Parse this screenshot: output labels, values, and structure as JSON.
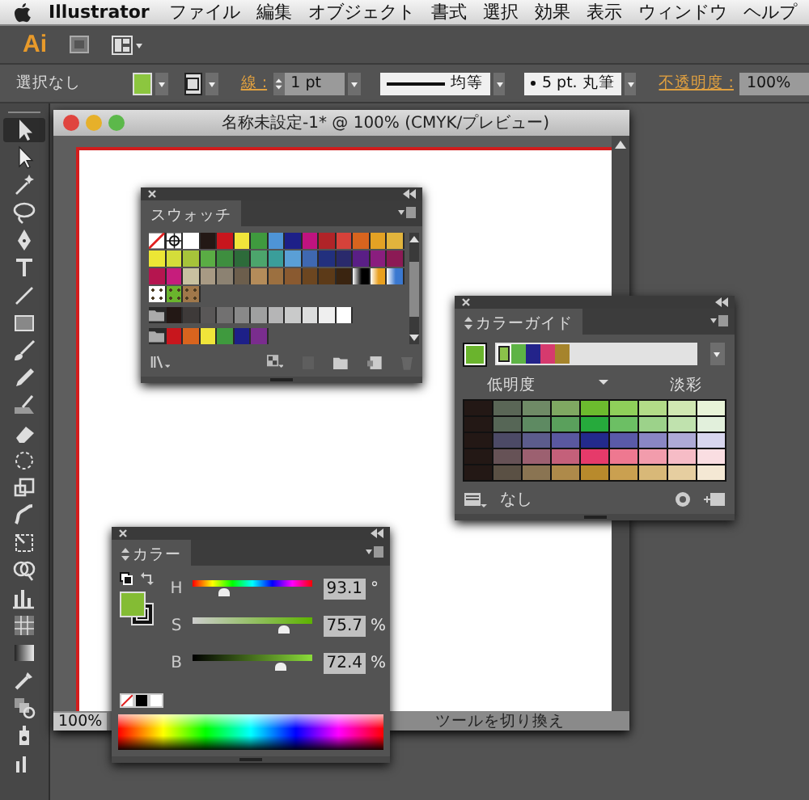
{
  "menu_bar": {
    "app": "Illustrator",
    "items": [
      "ファイル",
      "編集",
      "オブジェクト",
      "書式",
      "選択",
      "効果",
      "表示",
      "ウィンドウ",
      "ヘルプ"
    ]
  },
  "app_bar": {
    "logo": "Ai"
  },
  "control_bar": {
    "selection": "選択なし",
    "fill": {
      "color": "#8cc63f"
    },
    "stroke_label": "線 :",
    "stroke_weight": "1 pt",
    "stroke_profile": "均等",
    "brush": "5 pt. 丸筆",
    "opacity_label": "不透明度 :",
    "opacity": "100%"
  },
  "document": {
    "title": "名称未設定-1* @ 100% (CMYK/プレビュー)",
    "zoom": "100%",
    "status": "ツールを切り換え"
  },
  "swatches_panel": {
    "tab": "スウォッチ",
    "rows": [
      [
        {
          "kind": "none"
        },
        {
          "kind": "registration"
        },
        {
          "kind": "solid",
          "color": "#ffffff"
        },
        {
          "kind": "solid",
          "color": "#231815"
        },
        {
          "kind": "solid",
          "color": "#c8161d"
        },
        {
          "kind": "solid",
          "color": "#f0e53a"
        },
        {
          "kind": "solid",
          "color": "#3f9a3e"
        },
        {
          "kind": "solid",
          "color": "#4e94d6"
        },
        {
          "kind": "solid",
          "color": "#1d2088"
        },
        {
          "kind": "solid",
          "color": "#c0137f"
        },
        {
          "kind": "solid",
          "color": "#b02428"
        },
        {
          "kind": "solid",
          "color": "#d6423a"
        },
        {
          "kind": "solid",
          "color": "#d8641e"
        },
        {
          "kind": "solid",
          "color": "#e4a224"
        },
        {
          "kind": "solid",
          "color": "#e2b43c"
        }
      ],
      [
        {
          "kind": "solid",
          "color": "#ece635"
        },
        {
          "kind": "solid",
          "color": "#d4dd3a"
        },
        {
          "kind": "solid",
          "color": "#a6c43a"
        },
        {
          "kind": "solid",
          "color": "#5aad44"
        },
        {
          "kind": "solid",
          "color": "#3e8e3f"
        },
        {
          "kind": "solid",
          "color": "#2d6b3a"
        },
        {
          "kind": "solid",
          "color": "#4ca56c"
        },
        {
          "kind": "solid",
          "color": "#3a9e9a"
        },
        {
          "kind": "solid",
          "color": "#5a9fd6"
        },
        {
          "kind": "solid",
          "color": "#3f68b0"
        },
        {
          "kind": "solid",
          "color": "#22307e"
        },
        {
          "kind": "solid",
          "color": "#2a2a6c"
        },
        {
          "kind": "solid",
          "color": "#5a1f86"
        },
        {
          "kind": "solid",
          "color": "#8a1e7e"
        },
        {
          "kind": "solid",
          "color": "#8c1a55"
        }
      ],
      [
        {
          "kind": "solid",
          "color": "#b5154f"
        },
        {
          "kind": "solid",
          "color": "#c61d7c"
        },
        {
          "kind": "solid",
          "color": "#c8c1a0"
        },
        {
          "kind": "solid",
          "color": "#a89a84"
        },
        {
          "kind": "solid",
          "color": "#8c8272"
        },
        {
          "kind": "solid",
          "color": "#6c5e4c"
        },
        {
          "kind": "solid",
          "color": "#b48c5a"
        },
        {
          "kind": "solid",
          "color": "#9c7040"
        },
        {
          "kind": "solid",
          "color": "#8a5a30"
        },
        {
          "kind": "solid",
          "color": "#6c4620"
        },
        {
          "kind": "solid",
          "color": "#5c3a18"
        },
        {
          "kind": "solid",
          "color": "#3a2410"
        },
        {
          "kind": "gradient",
          "color": "#000000"
        },
        {
          "kind": "gradient",
          "color": "#e8a020"
        },
        {
          "kind": "gradient",
          "color": "#3a78d0"
        }
      ],
      [
        {
          "kind": "pattern",
          "color": "#ffffff"
        },
        {
          "kind": "pattern",
          "color": "#6ab42d"
        },
        {
          "kind": "pattern",
          "color": "#a0784a"
        }
      ],
      [
        {
          "kind": "folder"
        },
        {
          "kind": "solid",
          "color": "#231815"
        },
        {
          "kind": "solid",
          "color": "#3e3a39"
        },
        {
          "kind": "solid",
          "color": "#595757"
        },
        {
          "kind": "solid",
          "color": "#727171"
        },
        {
          "kind": "solid",
          "color": "#898989"
        },
        {
          "kind": "solid",
          "color": "#9fa0a0"
        },
        {
          "kind": "solid",
          "color": "#b5b5b6"
        },
        {
          "kind": "solid",
          "color": "#c9caca"
        },
        {
          "kind": "solid",
          "color": "#dcdddd"
        },
        {
          "kind": "solid",
          "color": "#efefef"
        },
        {
          "kind": "solid",
          "color": "#ffffff"
        }
      ],
      [
        {
          "kind": "folder"
        },
        {
          "kind": "solid",
          "color": "#c8161d"
        },
        {
          "kind": "solid",
          "color": "#d8641e"
        },
        {
          "kind": "solid",
          "color": "#f0e53a"
        },
        {
          "kind": "solid",
          "color": "#3f9a3e"
        },
        {
          "kind": "solid",
          "color": "#1d2088"
        },
        {
          "kind": "solid",
          "color": "#7a2d8e"
        }
      ]
    ]
  },
  "color_guide_panel": {
    "tab": "カラーガイド",
    "base": {
      "color": "#6ab42d"
    },
    "group": [
      {
        "color": "#8bc34a",
        "selected": true
      },
      {
        "color": "#5db345",
        "selected": false
      },
      {
        "color": "#23238a",
        "selected": false
      },
      {
        "color": "#d63a6e",
        "selected": false
      },
      {
        "color": "#a6842c",
        "selected": false
      }
    ],
    "left_label": "低明度",
    "right_label": "淡彩",
    "grid": [
      [
        {
          "color": "#231815"
        },
        {
          "color": "#5a6656"
        },
        {
          "color": "#6f8a66"
        },
        {
          "color": "#7fa862"
        },
        {
          "color": "#6cbb2e"
        },
        {
          "color": "#8fcf5a"
        },
        {
          "color": "#b3dc88"
        },
        {
          "color": "#d0e8b2"
        },
        {
          "color": "#e8f4d8"
        }
      ],
      [
        {
          "color": "#231815"
        },
        {
          "color": "#566656"
        },
        {
          "color": "#5e8a62"
        },
        {
          "color": "#5aa05c"
        },
        {
          "color": "#26aa3c"
        },
        {
          "color": "#6cbf64"
        },
        {
          "color": "#9cd28a"
        },
        {
          "color": "#c0e2ae"
        },
        {
          "color": "#e2f0dc"
        }
      ],
      [
        {
          "color": "#231815"
        },
        {
          "color": "#4c4a66"
        },
        {
          "color": "#5c5c8c"
        },
        {
          "color": "#5a58a0"
        },
        {
          "color": "#232a8c"
        },
        {
          "color": "#5a5aa8"
        },
        {
          "color": "#8a86c4"
        },
        {
          "color": "#aeaad6"
        },
        {
          "color": "#d8d6ee"
        }
      ],
      [
        {
          "color": "#231815"
        },
        {
          "color": "#665256"
        },
        {
          "color": "#9c6070"
        },
        {
          "color": "#c4607a"
        },
        {
          "color": "#e63a6a"
        },
        {
          "color": "#ee7890"
        },
        {
          "color": "#f29cac"
        },
        {
          "color": "#f6bcc6"
        },
        {
          "color": "#fadee2"
        }
      ],
      [
        {
          "color": "#231815"
        },
        {
          "color": "#5a5044"
        },
        {
          "color": "#8a7452"
        },
        {
          "color": "#ae8a4a"
        },
        {
          "color": "#b88a2c"
        },
        {
          "color": "#caa050"
        },
        {
          "color": "#d8b878"
        },
        {
          "color": "#e6cea0"
        },
        {
          "color": "#f4e8d4"
        }
      ]
    ],
    "footer": "なし"
  },
  "color_panel": {
    "tab": "カラー",
    "fill": {
      "color": "#84bc34"
    },
    "channels": [
      {
        "kind": "hue",
        "label": "H",
        "value": "93.1",
        "unit": "°",
        "level": 0.26
      },
      {
        "kind": "saturation",
        "label": "S",
        "value": "75.7",
        "unit": "%",
        "level": 0.757
      },
      {
        "kind": "brightness",
        "label": "B",
        "value": "72.4",
        "unit": "%",
        "level": 0.724
      }
    ]
  }
}
